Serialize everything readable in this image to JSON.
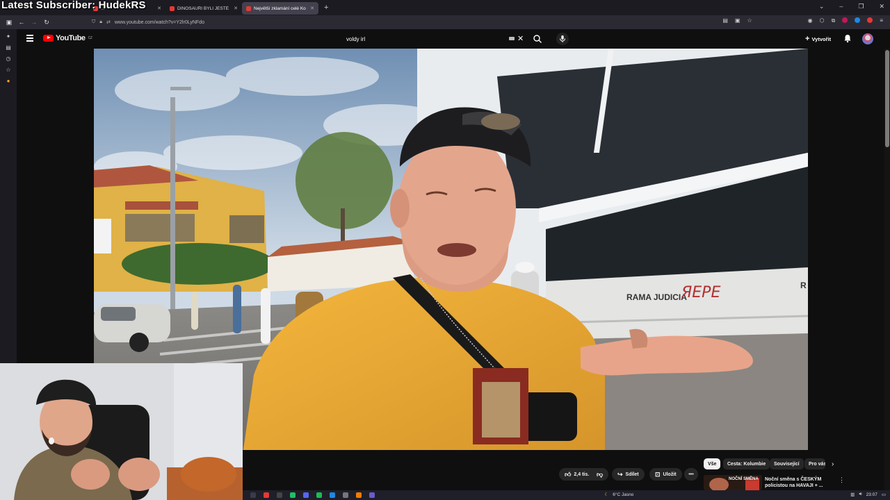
{
  "stream_overlay": {
    "title": "Latest Subscriber: HudekRS"
  },
  "browser": {
    "tabs": [
      {
        "label": "...",
        "active": false,
        "favicon_color": "#e53935"
      },
      {
        "label": "DINOSAUŘI BYLI JEŠTĚ HORŠÍ",
        "active": false,
        "favicon_color": "#e53935"
      },
      {
        "label": "Největší zklamání celé Kolumbi",
        "active": true,
        "favicon_color": "#e53935"
      }
    ],
    "new_tab_label": "+",
    "url": "www.youtube.com/watch?v=Y2lr0LyNFdo"
  },
  "youtube": {
    "logo_text": "YouTube",
    "logo_region": "CZ",
    "search": {
      "value": "voldy irl"
    },
    "create_label": "Vytvořit"
  },
  "video_scene": {
    "barrier_text": "RAMA JUDICIA",
    "barrier_text_2": "R"
  },
  "actions": {
    "like_count": "2,4 tis.",
    "share_label": "Sdílet",
    "save_label": "Uložit"
  },
  "chips": [
    "Vše",
    "Cesta: Kolumbie",
    "Související",
    "Pro vás"
  ],
  "recommendation": {
    "title": "Noční směna s ČESKÝM policistou na HAVAJI + ...",
    "thumb_text": "NOČNÍ SMĚNA"
  },
  "taskbar": {
    "weather": "6°C  Jasno",
    "time": "23:07"
  },
  "colors": {
    "youtube_red": "#ff0000",
    "page_bg": "#0f0f0f",
    "chip_bg": "#272727",
    "shirt_yellow": "#f0b23a"
  }
}
